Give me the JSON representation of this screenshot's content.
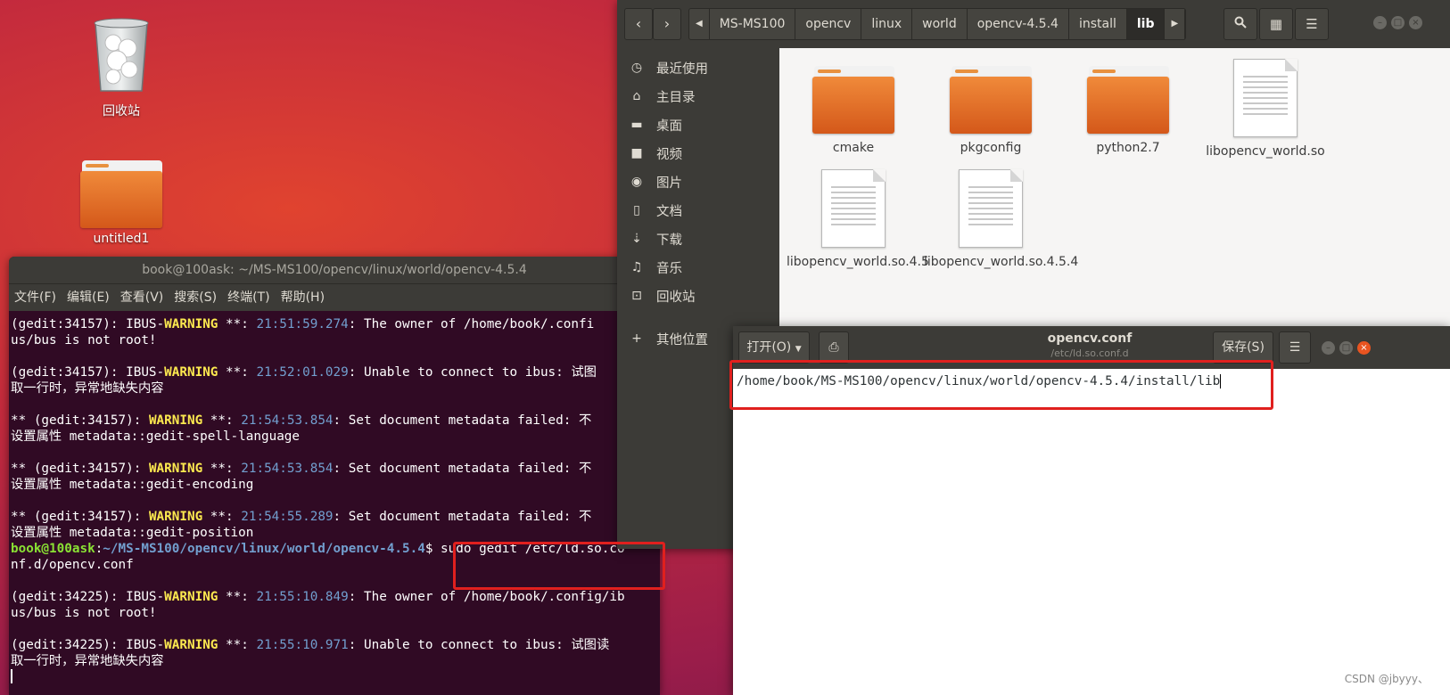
{
  "desktop": {
    "trash_label": "回收站",
    "folder_label": "untitled1"
  },
  "terminal": {
    "title": "book@100ask: ~/MS-MS100/opencv/linux/world/opencv-4.5.4",
    "menu": [
      "文件(F)",
      "编辑(E)",
      "查看(V)",
      "搜索(S)",
      "终端(T)",
      "帮助(H)"
    ],
    "lines": [
      [
        {
          "t": "(gedit:34157): IBUS-",
          "c": ""
        },
        {
          "t": "WARNING",
          "c": "warn"
        },
        {
          "t": " **: ",
          "c": ""
        },
        {
          "t": "21:51:59.274",
          "c": "ts"
        },
        {
          "t": ": The owner of /home/book/.confi",
          "c": ""
        }
      ],
      [
        {
          "t": "us/bus is not root!",
          "c": ""
        }
      ],
      [
        {
          "t": "",
          "c": ""
        }
      ],
      [
        {
          "t": "(gedit:34157): IBUS-",
          "c": ""
        },
        {
          "t": "WARNING",
          "c": "warn"
        },
        {
          "t": " **: ",
          "c": ""
        },
        {
          "t": "21:52:01.029",
          "c": "ts"
        },
        {
          "t": ": Unable to connect to ibus: 试图",
          "c": ""
        }
      ],
      [
        {
          "t": "取一行时，异常地缺失内容",
          "c": ""
        }
      ],
      [
        {
          "t": "",
          "c": ""
        }
      ],
      [
        {
          "t": "** (gedit:34157): ",
          "c": ""
        },
        {
          "t": "WARNING",
          "c": "warn"
        },
        {
          "t": " **: ",
          "c": ""
        },
        {
          "t": "21:54:53.854",
          "c": "ts"
        },
        {
          "t": ": Set document metadata failed: 不",
          "c": ""
        }
      ],
      [
        {
          "t": "设置属性 metadata::gedit-spell-language",
          "c": ""
        }
      ],
      [
        {
          "t": "",
          "c": ""
        }
      ],
      [
        {
          "t": "** (gedit:34157): ",
          "c": ""
        },
        {
          "t": "WARNING",
          "c": "warn"
        },
        {
          "t": " **: ",
          "c": ""
        },
        {
          "t": "21:54:53.854",
          "c": "ts"
        },
        {
          "t": ": Set document metadata failed: 不",
          "c": ""
        }
      ],
      [
        {
          "t": "设置属性 metadata::gedit-encoding",
          "c": ""
        }
      ],
      [
        {
          "t": "",
          "c": ""
        }
      ],
      [
        {
          "t": "** (gedit:34157): ",
          "c": ""
        },
        {
          "t": "WARNING",
          "c": "warn"
        },
        {
          "t": " **: ",
          "c": ""
        },
        {
          "t": "21:54:55.289",
          "c": "ts"
        },
        {
          "t": ": Set document metadata failed: 不",
          "c": ""
        }
      ],
      [
        {
          "t": "设置属性 metadata::gedit-position",
          "c": ""
        }
      ],
      [
        {
          "t": "book@100ask",
          "c": "prompt-user"
        },
        {
          "t": ":",
          "c": ""
        },
        {
          "t": "~/MS-MS100/opencv/linux/world/opencv-4.5.4",
          "c": "prompt-path"
        },
        {
          "t": "$ sudo gedit /etc/ld.so.co",
          "c": ""
        }
      ],
      [
        {
          "t": "nf.d/opencv.conf",
          "c": ""
        }
      ],
      [
        {
          "t": "",
          "c": ""
        }
      ],
      [
        {
          "t": "(gedit:34225): IBUS-",
          "c": ""
        },
        {
          "t": "WARNING",
          "c": "warn"
        },
        {
          "t": " **: ",
          "c": ""
        },
        {
          "t": "21:55:10.849",
          "c": "ts"
        },
        {
          "t": ": The owner of /home/book/.config/ib",
          "c": ""
        }
      ],
      [
        {
          "t": "us/bus is not root!",
          "c": ""
        }
      ],
      [
        {
          "t": "",
          "c": ""
        }
      ],
      [
        {
          "t": "(gedit:34225): IBUS-",
          "c": ""
        },
        {
          "t": "WARNING",
          "c": "warn"
        },
        {
          "t": " **: ",
          "c": ""
        },
        {
          "t": "21:55:10.971",
          "c": "ts"
        },
        {
          "t": ": Unable to connect to ibus: 试图读",
          "c": ""
        }
      ],
      [
        {
          "t": "取一行时，异常地缺失内容",
          "c": ""
        }
      ]
    ]
  },
  "files": {
    "breadcrumbs": [
      "MS-MS100",
      "opencv",
      "linux",
      "world",
      "opencv-4.5.4",
      "install",
      "lib"
    ],
    "sidebar": [
      {
        "icon": "clock-icon",
        "glyph": "◷",
        "label": "最近使用"
      },
      {
        "icon": "home-icon",
        "glyph": "⌂",
        "label": "主目录"
      },
      {
        "icon": "desktop-folder-icon",
        "glyph": "▬",
        "label": "桌面"
      },
      {
        "icon": "video-icon",
        "glyph": "■",
        "label": "视频"
      },
      {
        "icon": "camera-icon",
        "glyph": "◉",
        "label": "图片"
      },
      {
        "icon": "document-icon",
        "glyph": "▯",
        "label": "文档"
      },
      {
        "icon": "download-icon",
        "glyph": "⇣",
        "label": "下载"
      },
      {
        "icon": "music-icon",
        "glyph": "♫",
        "label": "音乐"
      },
      {
        "icon": "trash-icon",
        "glyph": "⊡",
        "label": "回收站"
      },
      {
        "icon": "plus-icon",
        "glyph": "+",
        "label": "其他位置"
      }
    ],
    "items": [
      {
        "type": "folder",
        "name": "cmake"
      },
      {
        "type": "folder",
        "name": "pkgconfig"
      },
      {
        "type": "folder",
        "name": "python2.7"
      },
      {
        "type": "file",
        "name": "libopencv_world.so"
      },
      {
        "type": "file",
        "name": "libopencv_world.so.4.5"
      },
      {
        "type": "file",
        "name": "libopencv_world.so.4.5.4"
      }
    ]
  },
  "gedit": {
    "open_label": "打开(O)",
    "title": "opencv.conf",
    "subtitle": "/etc/ld.so.conf.d",
    "save_label": "保存(S)",
    "content": "/home/book/MS-MS100/opencv/linux/world/opencv-4.5.4/install/lib"
  },
  "watermark": "CSDN @jbyyy、"
}
